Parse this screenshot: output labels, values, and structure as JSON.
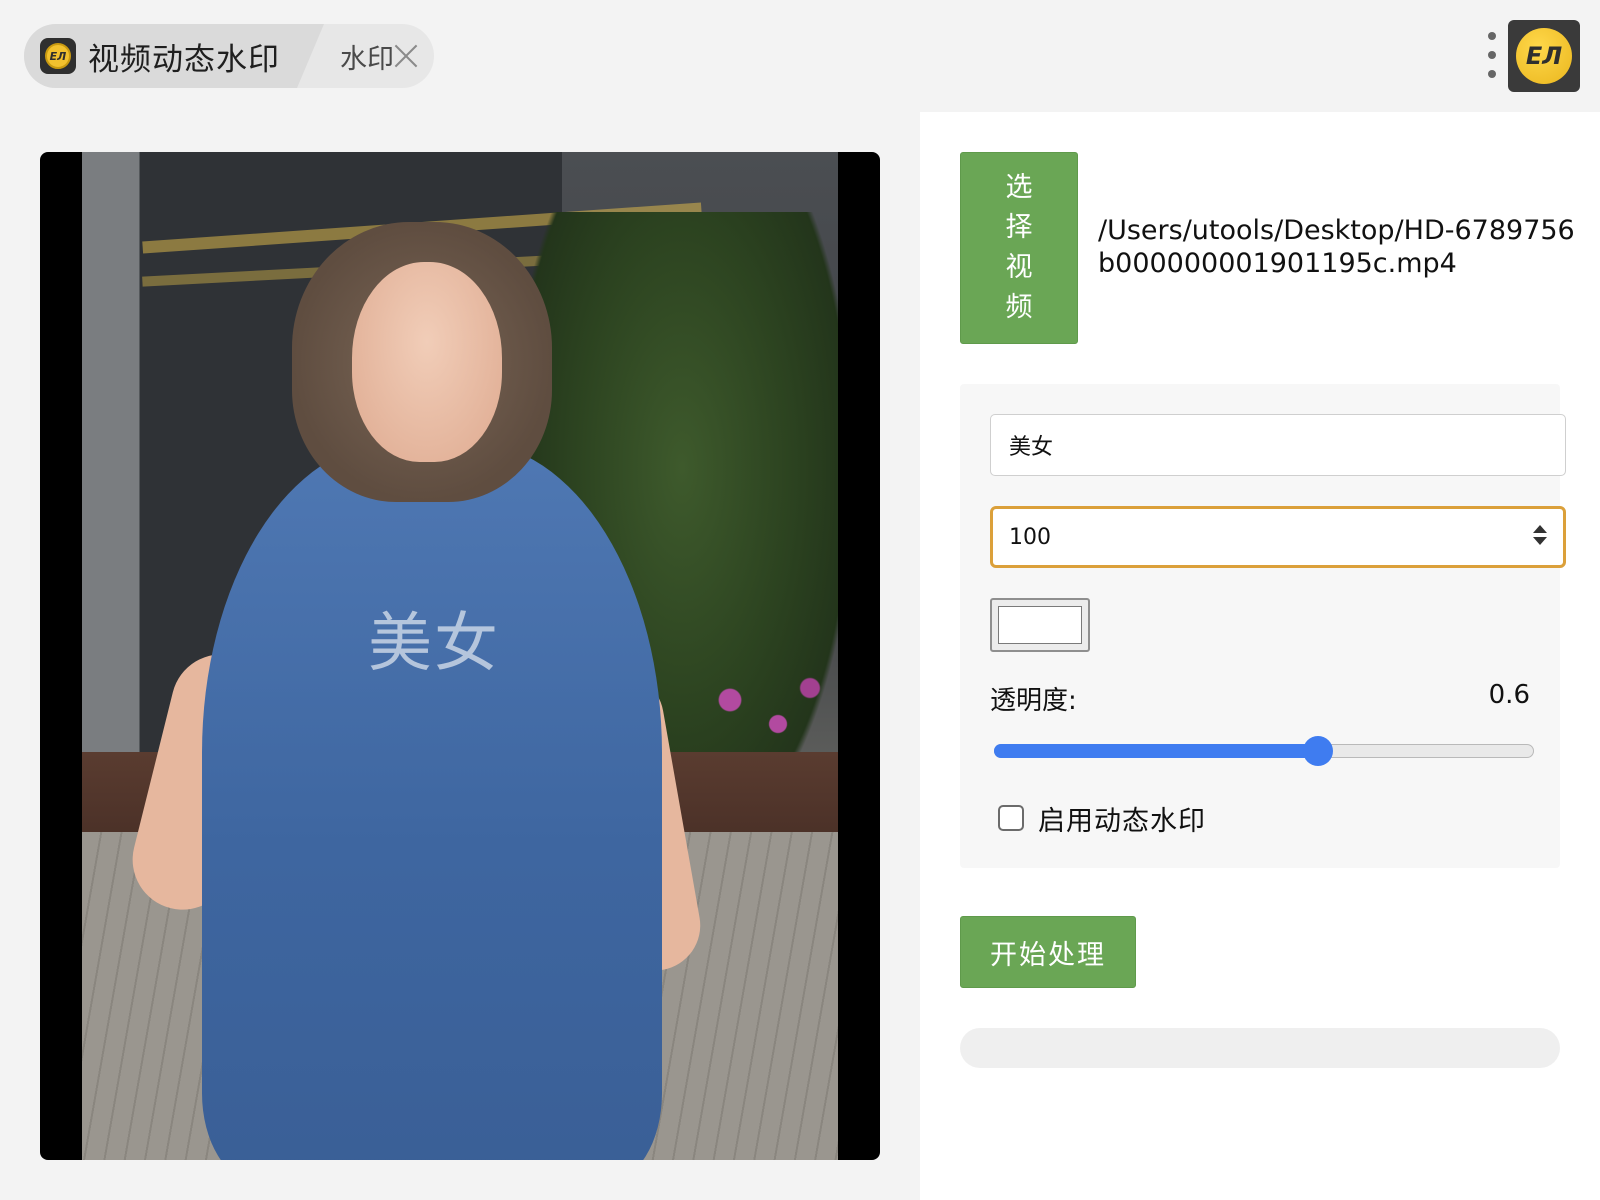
{
  "window": {
    "tab_title": "视频动态水印",
    "tab_sub_label": "水印",
    "app_badge_text": "ЕЛ",
    "logo_text": "ЕЛ"
  },
  "icons": {
    "tab_badge": "watermark-app-icon",
    "tab_close": "close-icon",
    "menu": "kebab-menu-icon",
    "app_logo": "watermark-logo-icon"
  },
  "preview": {
    "watermark_text": "美女"
  },
  "controls": {
    "select_video_label": "选择视频",
    "file_path": "/Users/utools/Desktop/HD-6789756b000000001901195c.mp4",
    "watermark_text_value": "美女",
    "font_size_value": "100",
    "color_value": "#ffffff",
    "opacity_label": "透明度:",
    "opacity_value": "0.6",
    "opacity_fraction": 0.6,
    "dynamic_label": "启用动态水印",
    "dynamic_checked": false,
    "start_label": "开始处理",
    "progress_fraction": 0
  },
  "colors": {
    "accent_green": "#6aa655",
    "focus_orange": "#dba03a",
    "slider_blue": "#3f7cf0"
  }
}
